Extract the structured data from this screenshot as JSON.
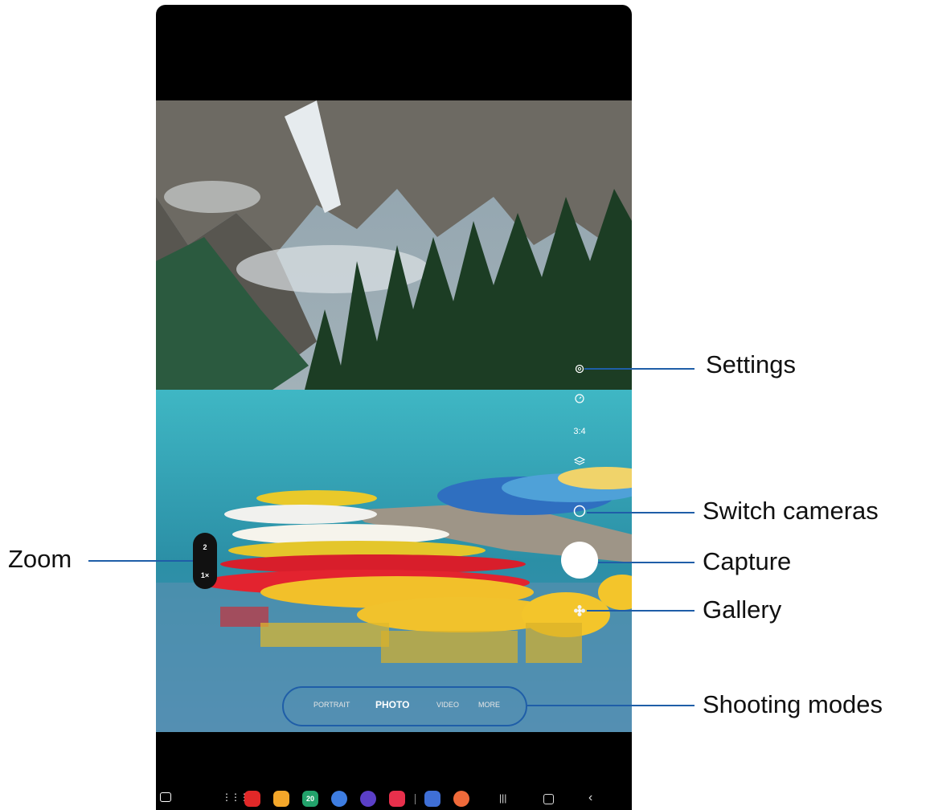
{
  "camera": {
    "aspect_ratio_label": "3:4",
    "zoom_levels": [
      "2",
      "1×"
    ],
    "modes": [
      "PORTRAIT",
      "PHOTO",
      "VIDEO",
      "MORE"
    ],
    "active_mode": "PHOTO",
    "calendar_app_date": "20"
  },
  "callouts": {
    "settings": "Settings",
    "switch_cameras": "Switch cameras",
    "capture": "Capture",
    "gallery": "Gallery",
    "shooting_modes": "Shooting modes",
    "zoom": "Zoom"
  },
  "colors": {
    "callout_line": "#1f5ea8",
    "background": "#ffffff"
  },
  "taskbar_icons": [
    "apps-grid-icon",
    "flipboard-icon",
    "files-icon",
    "calendar-icon",
    "messages-icon",
    "internet-icon",
    "screen-recorder-icon",
    "settings-icon",
    "contacts-icon"
  ],
  "nav_buttons": [
    "recents-icon",
    "home-icon",
    "back-icon"
  ]
}
